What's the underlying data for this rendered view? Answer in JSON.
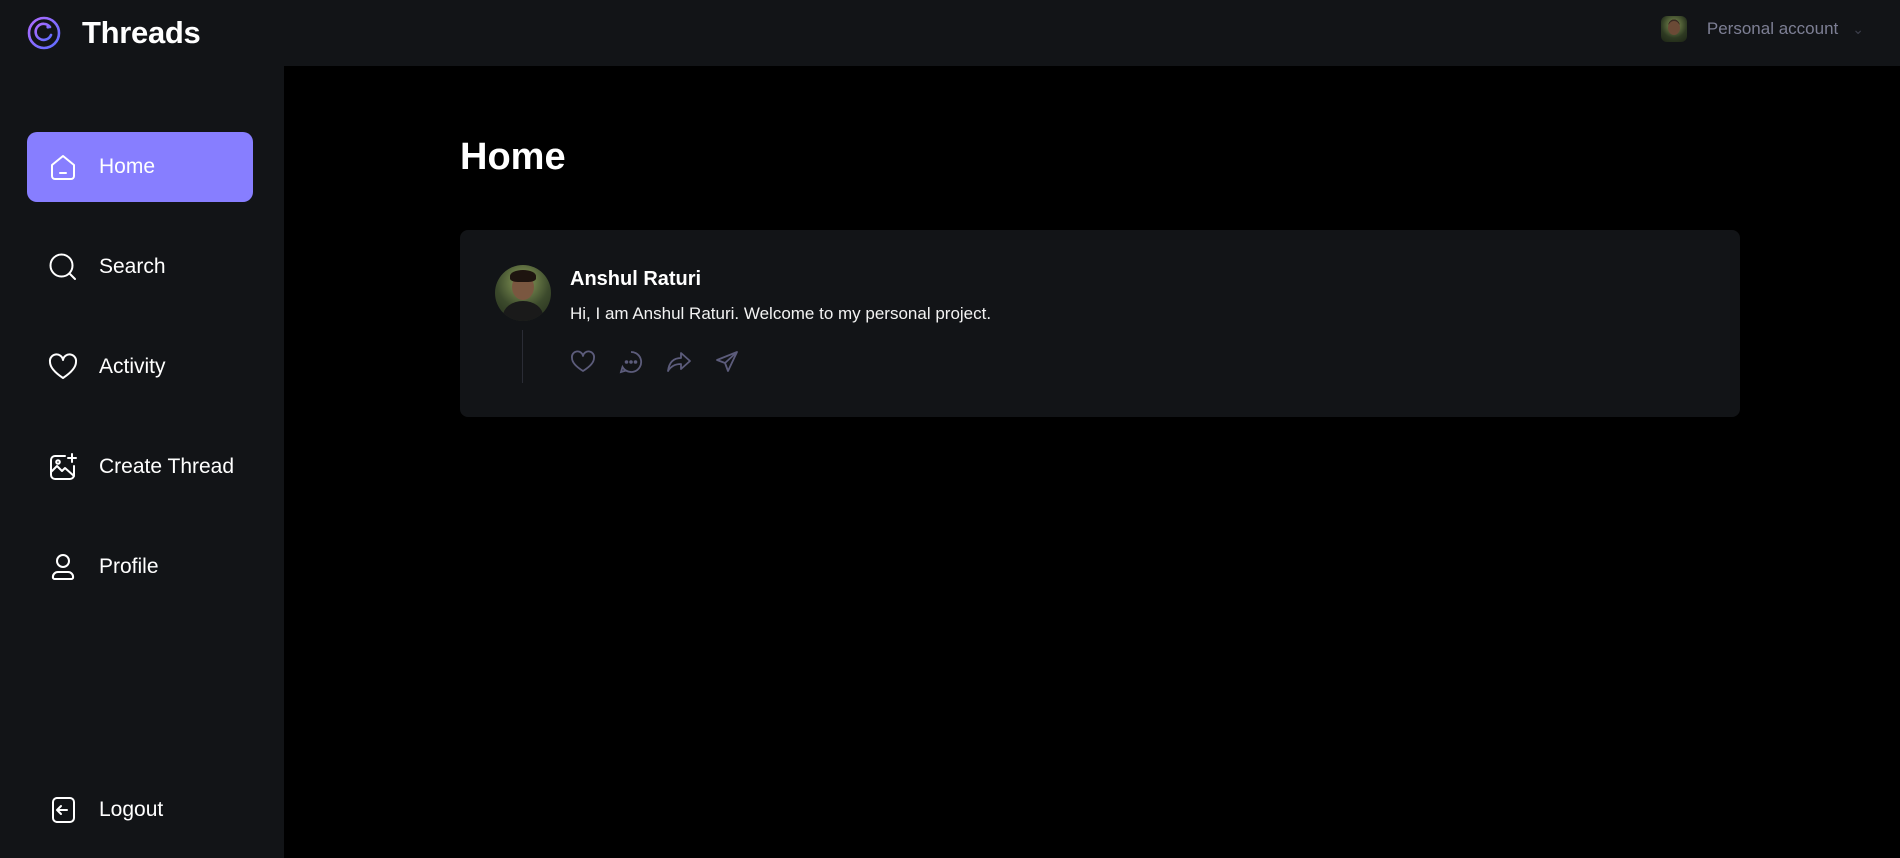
{
  "header": {
    "brand_name": "Threads",
    "account_label": "Personal account"
  },
  "sidebar": {
    "items": [
      {
        "label": "Home",
        "icon": "home-icon",
        "active": true
      },
      {
        "label": "Search",
        "icon": "search-icon",
        "active": false
      },
      {
        "label": "Activity",
        "icon": "heart-icon",
        "active": false
      },
      {
        "label": "Create Thread",
        "icon": "create-thread-icon",
        "active": false
      },
      {
        "label": "Profile",
        "icon": "user-icon",
        "active": false
      }
    ],
    "logout_label": "Logout"
  },
  "main": {
    "title": "Home",
    "threads": [
      {
        "author": "Anshul Raturi",
        "text": "Hi, I am Anshul Raturi. Welcome to my personal project."
      }
    ]
  },
  "colors": {
    "accent": "#877eff",
    "panel": "#121417",
    "background": "#000000",
    "muted": "#7d7f94"
  }
}
